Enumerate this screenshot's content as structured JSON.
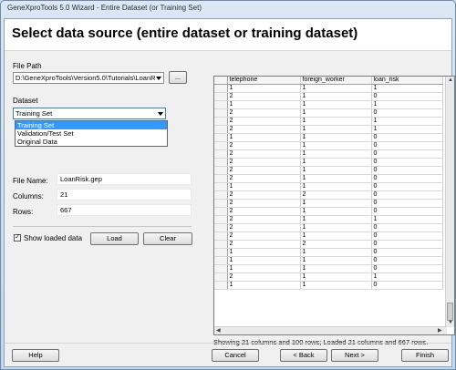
{
  "window": {
    "title": "GeneXproTools 5.0 Wizard - Entire Dataset (or Training Set)"
  },
  "header": {
    "title": "Select data source (entire dataset or training dataset)"
  },
  "file_path": {
    "label": "File Path",
    "value": "D:\\GeneXproTools\\Version5.0\\Tutorials\\LoanR",
    "browse_label": "..."
  },
  "dataset": {
    "label": "Dataset",
    "selected": "Training Set",
    "options": [
      "Training Set",
      "Validation/Test Set",
      "Original Data"
    ]
  },
  "info": {
    "file_name_label": "File Name:",
    "file_name": "LoanRisk.gep",
    "columns_label": "Columns:",
    "columns": "21",
    "rows_label": "Rows:",
    "rows": "667"
  },
  "show_loaded": {
    "label": "Show loaded data",
    "checked": "✓"
  },
  "buttons": {
    "load": "Load",
    "clear": "Clear",
    "help": "Help",
    "cancel": "Cancel",
    "back": "< Back",
    "next": "Next >",
    "finish": "Finish"
  },
  "grid": {
    "columns": [
      "telephone",
      "foreign_worker",
      "loan_risk"
    ],
    "rows": [
      [
        "1",
        "1",
        "1"
      ],
      [
        "2",
        "1",
        "0"
      ],
      [
        "1",
        "1",
        "1"
      ],
      [
        "2",
        "1",
        "0"
      ],
      [
        "2",
        "1",
        "1"
      ],
      [
        "2",
        "1",
        "1"
      ],
      [
        "1",
        "1",
        "0"
      ],
      [
        "2",
        "1",
        "0"
      ],
      [
        "2",
        "1",
        "0"
      ],
      [
        "2",
        "1",
        "0"
      ],
      [
        "2",
        "1",
        "0"
      ],
      [
        "2",
        "1",
        "0"
      ],
      [
        "1",
        "1",
        "0"
      ],
      [
        "2",
        "2",
        "0"
      ],
      [
        "2",
        "1",
        "0"
      ],
      [
        "2",
        "1",
        "0"
      ],
      [
        "2",
        "1",
        "1"
      ],
      [
        "2",
        "1",
        "0"
      ],
      [
        "2",
        "1",
        "0"
      ],
      [
        "2",
        "2",
        "0"
      ],
      [
        "1",
        "1",
        "0"
      ],
      [
        "1",
        "1",
        "0"
      ],
      [
        "1",
        "1",
        "0"
      ],
      [
        "2",
        "1",
        "1"
      ],
      [
        "1",
        "1",
        "0"
      ]
    ],
    "status": "Showing 21 columns and 100 rows; Loaded 21 columns and 667 rows."
  }
}
